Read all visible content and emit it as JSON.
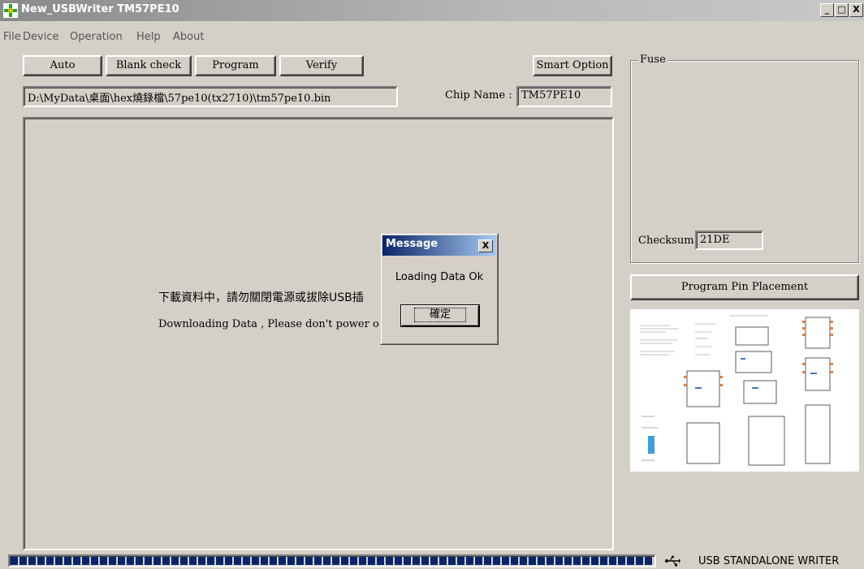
{
  "window": {
    "title": "New_USBWriter  TM57PE10",
    "minimize_label": "_",
    "maximize_label": "□",
    "close_label": "X"
  },
  "menu": {
    "items": [
      "File",
      "Device",
      "Operation",
      "Help",
      "About"
    ]
  },
  "toolbar": {
    "auto_label": "Auto",
    "blank_check_label": "Blank check",
    "program_label": "Program",
    "verify_label": "Verify",
    "smart_option_label": "Smart Option"
  },
  "file": {
    "path": "D:\\MyData\\桌面\\hex燒錄檔\\57pe10(tx2710)\\tm57pe10.bin"
  },
  "chip": {
    "label": "Chip Name :",
    "value": "TM57PE10"
  },
  "main": {
    "message_zh": "下載資料中，請勿關閉電源或拔除USB插",
    "message_en": "Downloading Data , Please don't power off"
  },
  "fuse": {
    "group_label": "Fuse",
    "checksum_label": "Checksum",
    "checksum_value": "21DE"
  },
  "pin_placement": {
    "button_label": "Program Pin Placement"
  },
  "dialog": {
    "title": "Message",
    "close_label": "X",
    "text": "Loading Data Ok",
    "ok_label": "確定"
  },
  "progress": {
    "fraction": 1.0,
    "color": "#0a246a"
  },
  "status": {
    "icon": "usb-icon",
    "text": "USB STANDALONE WRITER"
  }
}
